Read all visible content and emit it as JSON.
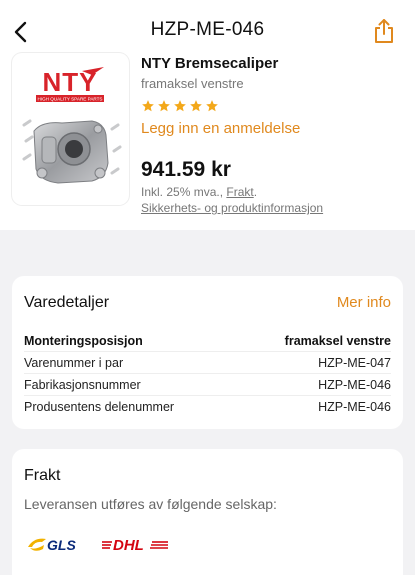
{
  "nav": {
    "title": "HZP-ME-046",
    "back_icon": "chevron-left-icon",
    "share_icon": "share-icon"
  },
  "product": {
    "brand_logo_text": "NTY",
    "brand_tagline": "HIGH QUALITY SPARE PARTS",
    "name": "NTY Bremsecaliper",
    "variant": "framaksel venstre",
    "rating_stars": 5,
    "review_link": "Legg inn en anmeldelse",
    "price": "941.59 kr",
    "tax_text": "Inkl. 25% mva., ",
    "freight_link": "Frakt",
    "tax_suffix": ".",
    "safety_link": "Sikkerhets- og produktinformasjon"
  },
  "details": {
    "title": "Varedetaljer",
    "more_link": "Mer info",
    "rows": [
      {
        "label": "Monteringsposisjon",
        "value": "framaksel venstre"
      },
      {
        "label": "Varenummer i par",
        "value": "HZP-ME-047"
      },
      {
        "label": "Fabrikasjonsnummer",
        "value": "HZP-ME-046"
      },
      {
        "label": "Produsentens delenummer",
        "value": "HZP-ME-046"
      }
    ]
  },
  "delivery": {
    "title": "Frakt",
    "subtitle": "Leveransen utføres av følgende selskap:",
    "carriers": [
      "GLS",
      "DHL"
    ]
  },
  "colors": {
    "accent": "#e0891e",
    "star": "#f3a81a",
    "brand_red": "#d8232a",
    "dhl_red": "#d40511"
  }
}
